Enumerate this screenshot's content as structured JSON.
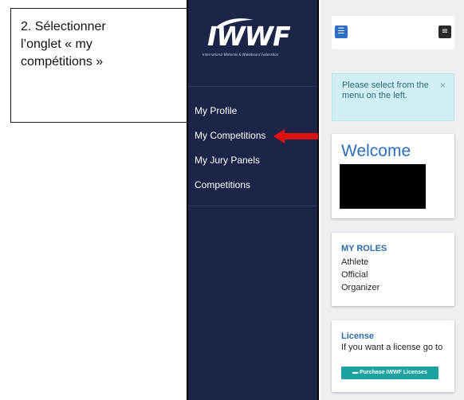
{
  "callout": {
    "lines": [
      "2. Sélectionner",
      "l’onglet « my",
      "compétitions »"
    ]
  },
  "logo": {
    "text": "IWWF",
    "subtitle": "International Waterski & Wakeboard Federation"
  },
  "sidebar": {
    "items": [
      {
        "label": "My Profile"
      },
      {
        "label": "My Competitions"
      },
      {
        "label": "My Jury Panels"
      },
      {
        "label": "Competitions"
      }
    ]
  },
  "alert": {
    "message": "Please select from the menu on the left.",
    "close_glyph": "×"
  },
  "welcome": {
    "title": "Welcome"
  },
  "roles": {
    "title": "MY ROLES",
    "items": [
      "Athlete",
      "Official",
      "Organizer"
    ]
  },
  "license": {
    "title": "License",
    "text": "If you want a license go to",
    "button_label": "Purchase IWWF Licenses",
    "button_icon": "credit-card-icon"
  },
  "colors": {
    "sidebar_bg": "#1c2447",
    "accent_blue": "#2a6fc4",
    "alert_bg": "#cfeff4",
    "license_button": "#1aa3a0",
    "arrow": "#e01010"
  }
}
